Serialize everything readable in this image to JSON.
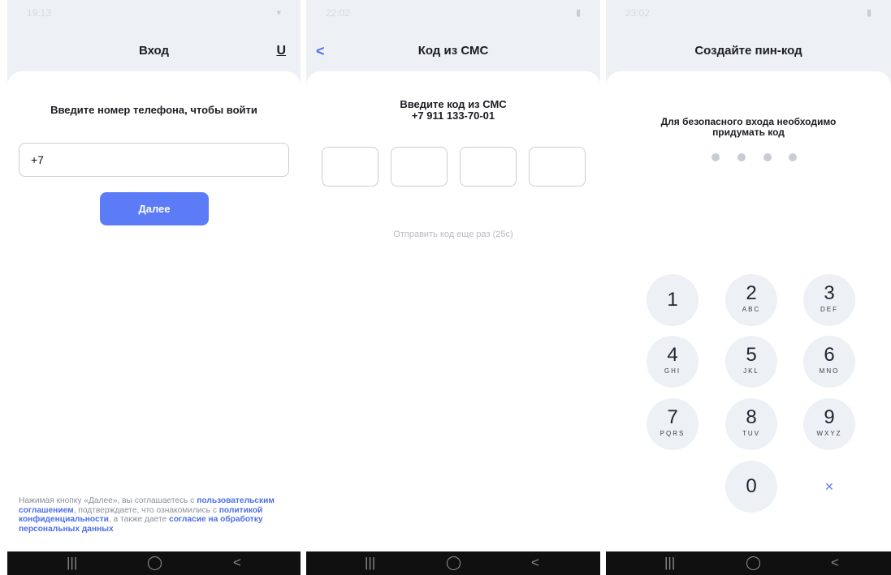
{
  "screen1": {
    "status_time": "19:13",
    "title": "Вход",
    "header_icon": "U",
    "prompt": "Введите номер телефона, чтобы войти",
    "phone_value": "+7",
    "next_button": "Далее",
    "legal": {
      "t1": "Нажимая кнопку «Далее», вы соглашаетесь с ",
      "l1": "пользовательским соглашением",
      "t2": ", подтверждаете, что ознакомились с ",
      "l2": "политикой конфиденциальности",
      "t3": ", а также даете ",
      "l3": "согласие на обработку персональных данных"
    }
  },
  "screen2": {
    "status_time": "22:02",
    "back_icon": "<",
    "title": "Код из СМС",
    "prompt_line1": "Введите код из СМС",
    "prompt_line2": "+7 911 133-70-01",
    "resend": "Отправить код еще раз (25с)"
  },
  "screen3": {
    "status_time": "23:02",
    "title": "Создайте пин-код",
    "prompt_line1": "Для безопасного входа необходимо",
    "prompt_line2": "придумать код",
    "keys": [
      {
        "num": "1",
        "letters": ""
      },
      {
        "num": "2",
        "letters": "ABC"
      },
      {
        "num": "3",
        "letters": "DEF"
      },
      {
        "num": "4",
        "letters": "GHI"
      },
      {
        "num": "5",
        "letters": "JKL"
      },
      {
        "num": "6",
        "letters": "MNO"
      },
      {
        "num": "7",
        "letters": "PQRS"
      },
      {
        "num": "8",
        "letters": "TUV"
      },
      {
        "num": "9",
        "letters": "WXYZ"
      },
      {
        "num": "0",
        "letters": ""
      }
    ],
    "delete_key": "×"
  },
  "navbar": {
    "recents": "|||",
    "home": "◯",
    "back": "<"
  },
  "colors": {
    "accent": "#5c7cf7",
    "link": "#4d6fe6",
    "background": "#edf1f6",
    "navbar": "#101010"
  }
}
